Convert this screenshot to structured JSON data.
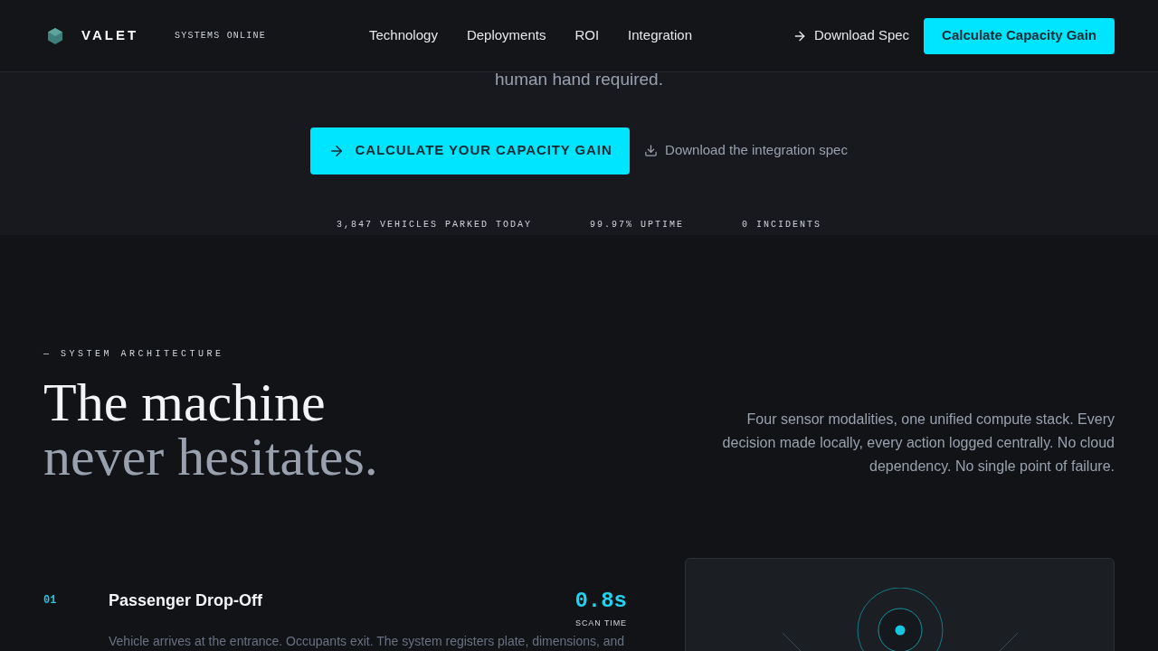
{
  "header": {
    "brand": "VALET",
    "status": "SYSTEMS ONLINE",
    "nav": [
      {
        "label": "Technology"
      },
      {
        "label": "Deployments"
      },
      {
        "label": "ROI"
      },
      {
        "label": "Integration"
      }
    ],
    "link": "Download Spec",
    "cta": "Calculate Capacity Gain"
  },
  "hero": {
    "tagline_end": "human hand required.",
    "primary": "CALCULATE YOUR CAPACITY GAIN",
    "secondary": "Download the integration spec",
    "stats": [
      "3,847 VEHICLES PARKED TODAY",
      "99.97% UPTIME",
      "0 INCIDENTS"
    ]
  },
  "architecture": {
    "eyebrow": "— SYSTEM ARCHITECTURE",
    "title_line1": "The machine",
    "title_line2": "never hesitates.",
    "description": "Four sensor modalities, one unified compute stack. Every decision made locally, every action logged centrally. No cloud dependency. No single point of failure.",
    "steps": [
      {
        "number": "01",
        "title": "Passenger Drop-Off",
        "metric": "0.8s",
        "metric_label": "SCAN TIME",
        "text": "Vehicle arrives at the entrance. Occupants exit. The system registers plate, dimensions, and"
      }
    ]
  }
}
